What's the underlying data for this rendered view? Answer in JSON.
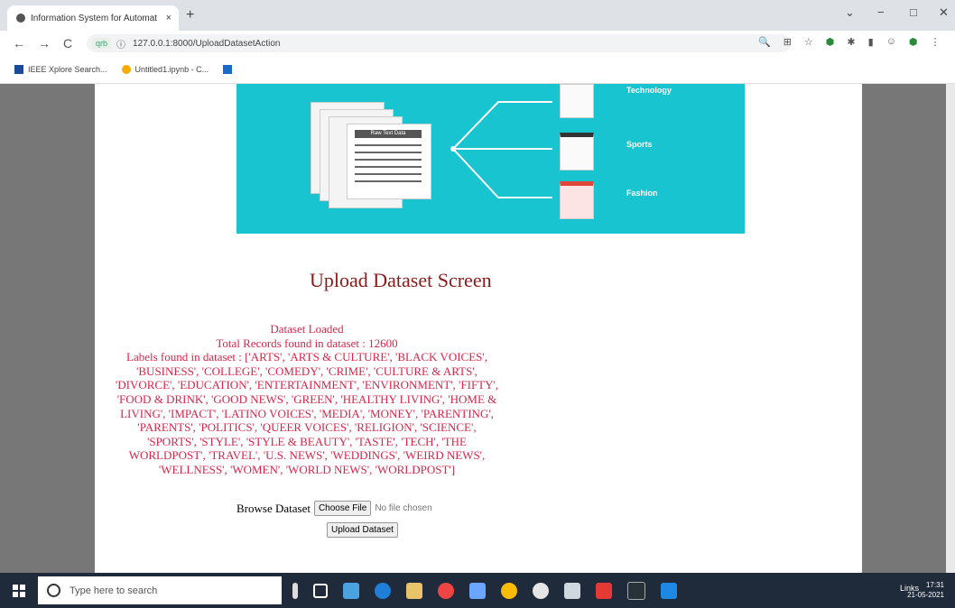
{
  "browser": {
    "tab_title": "Information System for Automat",
    "tab_close": "×",
    "new_tab": "+",
    "url": "127.0.0.1:8000/UploadDatasetAction",
    "badge": "qrb",
    "bookmarks": [
      "IEEE Xplore Search...",
      "Untitled1.ipynb - C...",
      ""
    ]
  },
  "page": {
    "banner": {
      "doc_label": "Raw Text Data",
      "categories": [
        "Technology",
        "Sports",
        "Fashion"
      ]
    },
    "heading": "Upload Dataset Screen",
    "status_lines": [
      "Dataset Loaded",
      "Total Records found in dataset : 12600",
      "Labels found in dataset : ['ARTS', 'ARTS & CULTURE', 'BLACK VOICES',",
      "'BUSINESS', 'COLLEGE', 'COMEDY', 'CRIME', 'CULTURE & ARTS',",
      "'DIVORCE', 'EDUCATION', 'ENTERTAINMENT', 'ENVIRONMENT', 'FIFTY',",
      "'FOOD & DRINK', 'GOOD NEWS', 'GREEN', 'HEALTHY LIVING', 'HOME &",
      "LIVING', 'IMPACT', 'LATINO VOICES', 'MEDIA', 'MONEY', 'PARENTING',",
      "'PARENTS', 'POLITICS', 'QUEER VOICES', 'RELIGION', 'SCIENCE',",
      "'SPORTS', 'STYLE', 'STYLE & BEAUTY', 'TASTE', 'TECH', 'THE",
      "WORLDPOST', 'TRAVEL', 'U.S. NEWS', 'WEDDINGS', 'WEIRD NEWS',",
      "'WELLNESS', 'WOMEN', 'WORLD NEWS', 'WORLDPOST']"
    ],
    "browse_label": "Browse Dataset",
    "choose_file": "Choose File",
    "no_file": "No file chosen",
    "upload_button": "Upload Dataset"
  },
  "taskbar": {
    "search_placeholder": "Type here to search",
    "tray_text": "Links",
    "time": "17:31",
    "date": "21-05-2021"
  },
  "colors": {
    "banner": "#17c4cf",
    "status_text": "#d9254a",
    "heading": "#8b1a1a"
  }
}
